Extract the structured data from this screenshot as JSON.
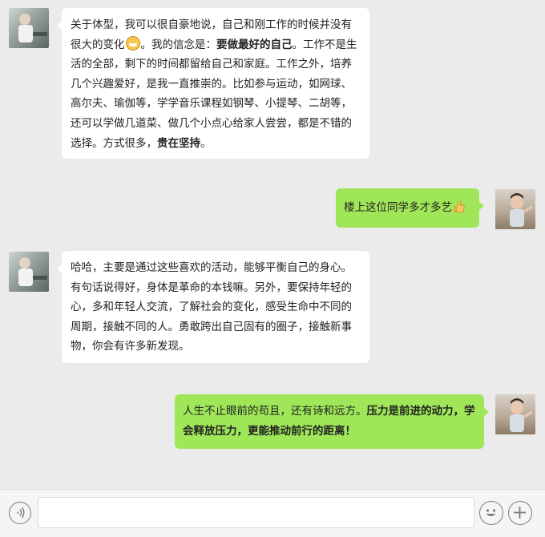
{
  "messages": [
    {
      "side": "left",
      "segments": [
        {
          "t": "关于体型，我可以很自豪地说，自己和刚工作的时候并没有很大的变化"
        },
        {
          "emoji": "grin-emoji"
        },
        {
          "t": "。我的信念是："
        },
        {
          "t": "要做最好的自己",
          "b": true
        },
        {
          "t": "。工作不是生活的全部，剩下的时间都留给自己和家庭。工作之外，培养几个兴趣爱好，是我一直推崇的。比如参与运动，如网球、高尔夫、瑜伽等，学学音乐课程如钢琴、小提琴、二胡等，还可以学做几道菜、做几个小点心给家人尝尝，都是不错的选择。方式很多，"
        },
        {
          "t": "贵在坚持",
          "b": true
        },
        {
          "t": "。"
        }
      ]
    },
    {
      "side": "right",
      "segments": [
        {
          "t": "楼上这位同学多才多艺"
        },
        {
          "emoji": "thumbs-up-emoji"
        }
      ]
    },
    {
      "side": "left",
      "segments": [
        {
          "t": "哈哈，主要是通过这些喜欢的活动，能够平衡自己的身心。有句话说得好，身体是革命的本钱嘛。另外，要保持年轻的心，多和年轻人交流，了解社会的变化，感受生命中不同的周期，接触不同的人。勇敢跨出自己固有的圈子，接触新事物，你会有许多新发现。"
        }
      ]
    },
    {
      "side": "right",
      "segments": [
        {
          "t": "人生不止眼前的苟且，还有诗和远方。"
        },
        {
          "t": "压力是前进的动力，学会释放压力，更能推动前行的距离！",
          "b": true
        }
      ]
    }
  ],
  "composer": {
    "value": "",
    "placeholder": ""
  },
  "colors": {
    "background": "#ebebeb",
    "outgoing_bubble": "#9fe658",
    "incoming_bubble": "#ffffff"
  },
  "icons": {
    "voice": "voice-icon",
    "emoji": "smiley-icon",
    "plus": "plus-icon"
  }
}
